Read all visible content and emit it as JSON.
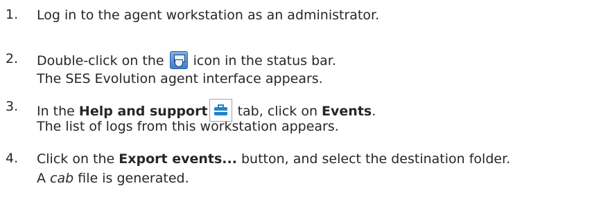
{
  "steps": [
    {
      "number": "1.",
      "line1": "Log in to the agent workstation as an administrator."
    },
    {
      "number": "2.",
      "line1_before_icon": "Double-click on the",
      "icon": "agent-shield-icon",
      "line1_after_icon": "icon in the status bar.",
      "line2": "The SES Evolution agent interface appears."
    },
    {
      "number": "3.",
      "line1_before_bold": "In the",
      "tab_name": "Help and support",
      "icon": "toolbox-icon",
      "line1_middle": "tab, click on",
      "events_label": "Events",
      "line1_end": ".",
      "line2": "The list of logs from this workstation appears."
    },
    {
      "number": "4.",
      "line1_before_bold": "Click on the",
      "button_name": "Export events...",
      "line1_after_bold": "button, and select the destination folder.",
      "line2_before_italic": "A",
      "file_type": "cab",
      "line2_after_italic": "file is generated."
    }
  ]
}
